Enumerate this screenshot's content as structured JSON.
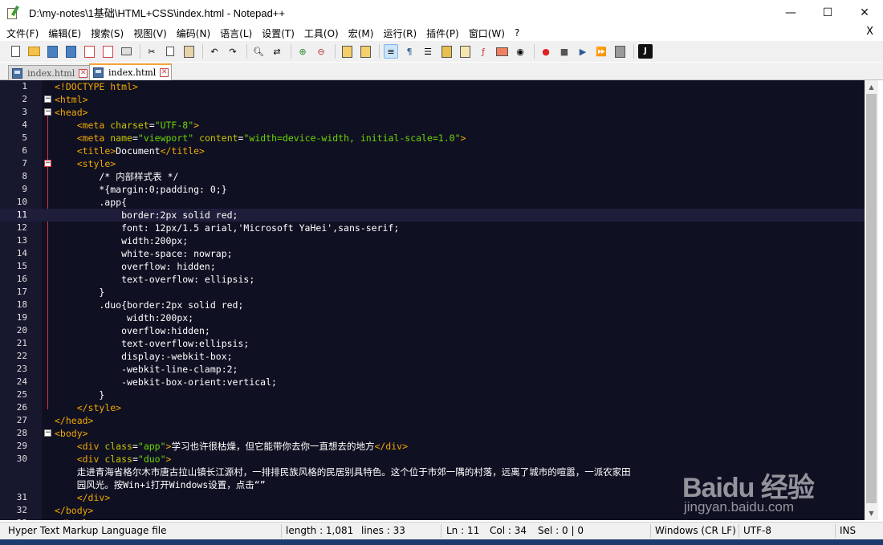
{
  "window": {
    "title": "D:\\my-notes\\1基础\\HTML+CSS\\index.html - Notepad++",
    "minimize": "—",
    "maximize": "☐",
    "close": "✕"
  },
  "menu": {
    "items": [
      "文件(F)",
      "编辑(E)",
      "搜索(S)",
      "视图(V)",
      "编码(N)",
      "语言(L)",
      "设置(T)",
      "工具(O)",
      "宏(M)",
      "运行(R)",
      "插件(P)",
      "窗口(W)",
      "?"
    ],
    "close": "X"
  },
  "toolbar": {
    "buttons": [
      "new-file-icon",
      "open-file-icon",
      "save-icon",
      "save-all-icon",
      "close-file-icon",
      "close-all-icon",
      "print-icon",
      "cut-icon",
      "copy-icon",
      "paste-icon",
      "undo-icon",
      "redo-icon",
      "find-icon",
      "replace-icon",
      "zoom-in-icon",
      "zoom-out-icon",
      "sync-vertical-icon",
      "sync-horizontal-icon",
      "word-wrap-icon",
      "show-all-chars-icon",
      "indent-guide-icon",
      "language-icon",
      "doc-map-icon",
      "function-list-icon",
      "folder-workspace-icon",
      "monitor-icon",
      "record-macro-icon",
      "stop-macro-icon",
      "play-macro-icon",
      "run-macro-multiple-icon",
      "save-macro-icon",
      "jslint-icon"
    ]
  },
  "tabs": [
    {
      "label": "index.html",
      "active": false
    },
    {
      "label": "index.html",
      "active": true
    }
  ],
  "editor": {
    "current_line": 11,
    "lines": [
      {
        "n": "1",
        "parts": [
          [
            "t",
            "<!DOCTYPE html>"
          ]
        ]
      },
      {
        "n": "2",
        "parts": [
          [
            "t",
            "<html>"
          ]
        ]
      },
      {
        "n": "3",
        "parts": [
          [
            "t",
            "<head>"
          ]
        ]
      },
      {
        "n": "4",
        "parts": [
          [
            "s",
            "    "
          ],
          [
            "t",
            "<meta "
          ],
          [
            "a",
            "charset"
          ],
          [
            "s",
            "="
          ],
          [
            "v",
            "\"UTF-8\""
          ],
          [
            "t",
            ">"
          ]
        ]
      },
      {
        "n": "5",
        "parts": [
          [
            "s",
            "    "
          ],
          [
            "t",
            "<meta "
          ],
          [
            "a",
            "name"
          ],
          [
            "s",
            "="
          ],
          [
            "v",
            "\"viewport\""
          ],
          [
            "s",
            " "
          ],
          [
            "a",
            "content"
          ],
          [
            "s",
            "="
          ],
          [
            "v",
            "\"width=device-width, initial-scale=1.0\""
          ],
          [
            "t",
            ">"
          ]
        ]
      },
      {
        "n": "6",
        "parts": [
          [
            "s",
            "    "
          ],
          [
            "t",
            "<title>"
          ],
          [
            "tx",
            "Document"
          ],
          [
            "t",
            "</title>"
          ]
        ]
      },
      {
        "n": "7",
        "parts": [
          [
            "s",
            "    "
          ],
          [
            "t",
            "<style>"
          ]
        ]
      },
      {
        "n": "8",
        "parts": [
          [
            "c",
            "        /* 内部样式表 */"
          ]
        ]
      },
      {
        "n": "9",
        "parts": [
          [
            "c",
            "        *{margin:0;padding: 0;}"
          ]
        ]
      },
      {
        "n": "10",
        "parts": [
          [
            "c",
            "        .app{"
          ]
        ]
      },
      {
        "n": "11",
        "parts": [
          [
            "c",
            "            border:2px solid red;"
          ]
        ]
      },
      {
        "n": "12",
        "parts": [
          [
            "c",
            "            font: 12px/1.5 arial,'Microsoft YaHei',sans-serif;"
          ]
        ]
      },
      {
        "n": "13",
        "parts": [
          [
            "c",
            "            width:200px;"
          ]
        ]
      },
      {
        "n": "14",
        "parts": [
          [
            "c",
            "            white-space: nowrap;"
          ]
        ]
      },
      {
        "n": "15",
        "parts": [
          [
            "c",
            "            overflow: hidden;"
          ]
        ]
      },
      {
        "n": "16",
        "parts": [
          [
            "c",
            "            text-overflow: ellipsis;"
          ]
        ]
      },
      {
        "n": "17",
        "parts": [
          [
            "c",
            "        }"
          ]
        ]
      },
      {
        "n": "18",
        "parts": [
          [
            "c",
            "        .duo{border:2px solid red;"
          ]
        ]
      },
      {
        "n": "19",
        "parts": [
          [
            "c",
            "             width:200px;"
          ]
        ]
      },
      {
        "n": "20",
        "parts": [
          [
            "c",
            "            overflow:hidden;"
          ]
        ]
      },
      {
        "n": "21",
        "parts": [
          [
            "c",
            "            text-overflow:ellipsis;"
          ]
        ]
      },
      {
        "n": "22",
        "parts": [
          [
            "c",
            "            display:-webkit-box;"
          ]
        ]
      },
      {
        "n": "23",
        "parts": [
          [
            "c",
            "            -webkit-line-clamp:2;"
          ]
        ]
      },
      {
        "n": "24",
        "parts": [
          [
            "c",
            "            -webkit-box-orient:vertical;"
          ]
        ]
      },
      {
        "n": "25",
        "parts": [
          [
            "c",
            "        }"
          ]
        ]
      },
      {
        "n": "26",
        "parts": [
          [
            "s",
            "    "
          ],
          [
            "t",
            "</style>"
          ]
        ]
      },
      {
        "n": "27",
        "parts": [
          [
            "t",
            "</head>"
          ]
        ]
      },
      {
        "n": "28",
        "parts": [
          [
            "t",
            "<body>"
          ]
        ]
      },
      {
        "n": "29",
        "parts": [
          [
            "s",
            "    "
          ],
          [
            "t",
            "<div "
          ],
          [
            "a",
            "class"
          ],
          [
            "s",
            "="
          ],
          [
            "v",
            "\"app\""
          ],
          [
            "t",
            ">"
          ],
          [
            "tx",
            "学习也许很枯燥，但它能带你去你一直想去的地方"
          ],
          [
            "t",
            "</div>"
          ]
        ]
      },
      {
        "n": "30",
        "parts": [
          [
            "s",
            "    "
          ],
          [
            "t",
            "<div "
          ],
          [
            "a",
            "class"
          ],
          [
            "s",
            "="
          ],
          [
            "v",
            "\"duo\""
          ],
          [
            "t",
            ">"
          ]
        ]
      },
      {
        "n": "",
        "parts": [
          [
            "tx",
            "    走进青海省格尔木市唐古拉山镇长江源村，一排排民族风格的民居别具特色。这个位于市郊一隅的村落，远离了城市的喧嚣，一派农家田"
          ]
        ]
      },
      {
        "n": "",
        "parts": [
          [
            "tx",
            "    园风光。按Win+i打开Windows设置，点击“”"
          ]
        ]
      },
      {
        "n": "31",
        "parts": [
          [
            "s",
            "    "
          ],
          [
            "t",
            "</div>"
          ]
        ]
      },
      {
        "n": "32",
        "parts": [
          [
            "t",
            "</body>"
          ]
        ]
      },
      {
        "n": "33",
        "parts": [
          [
            "t",
            "</html>"
          ]
        ]
      }
    ]
  },
  "status": {
    "file_type": "Hyper Text Markup Language file",
    "length": "length : 1,081",
    "lines": "lines : 33",
    "ln": "Ln : 11",
    "col": "Col : 34",
    "sel": "Sel : 0 | 0",
    "eol": "Windows (CR LF)",
    "encoding": "UTF-8",
    "mode": "INS"
  },
  "watermark": {
    "logo": "Baidu 经验",
    "url": "jingyan.baidu.com"
  },
  "colors": {
    "editor_bg": "#101023",
    "tag": "#f2a900",
    "attr": "#c8c800",
    "value": "#6bd600",
    "tab_accent": "#f6a43a"
  }
}
